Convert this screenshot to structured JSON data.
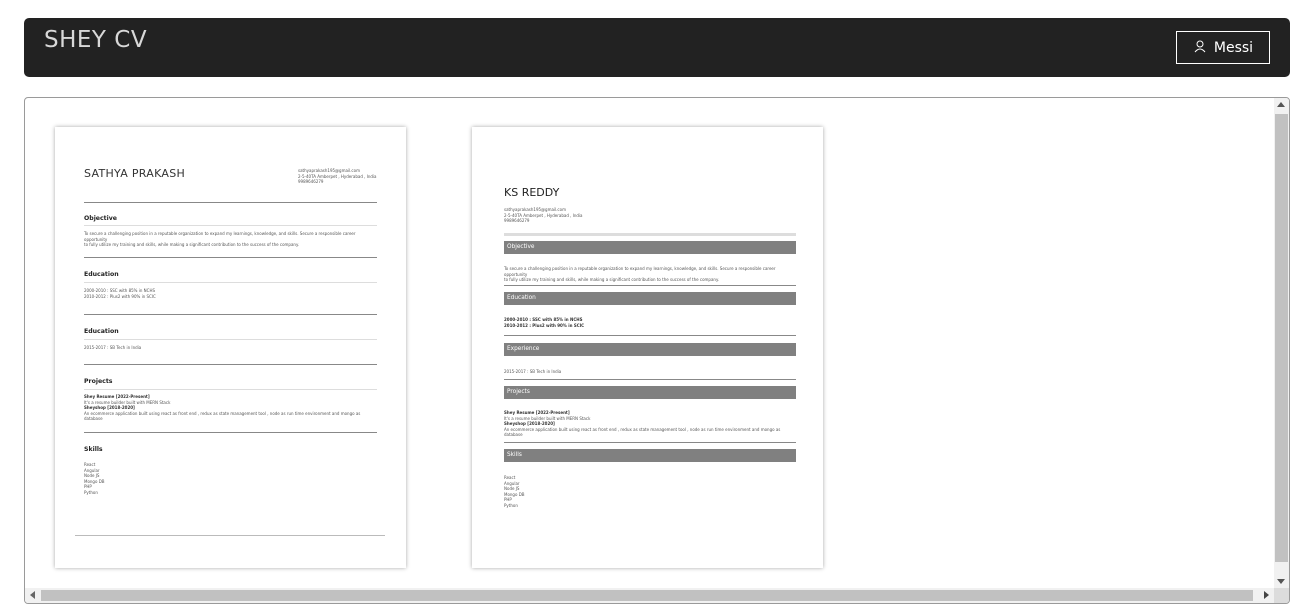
{
  "header": {
    "brand": "SHEY CV",
    "user_name": "Messi",
    "user_icon": "user-icon"
  },
  "templates": [
    {
      "name": "SATHYA PRAKASH",
      "contact": [
        "sathyaprakash195@gmail.com",
        "2-5-40TA Amberpet , Hyderabad , India",
        "9989646279"
      ],
      "sections": [
        {
          "title": "Objective",
          "lines": [
            "To secure a challenging position in a reputable organization to expand my learnings, knowledge, and skills. Secure a responsible career opportunity",
            "to fully utilize my training and skills, while making a significant contribution to the success of the company."
          ]
        },
        {
          "title": "Education",
          "lines": [
            "2000-2010 :  SSC with 85% in NCHS",
            "2010-2012 :  Plus2 with 90% in SCIC"
          ]
        },
        {
          "title": "Education",
          "lines": [
            "2015-2017 :  SB Tech in India"
          ]
        },
        {
          "title": "Projects",
          "lines": [
            "Shey Resume [2022-Present]",
            "It's a resume builder built with MERN Stack",
            "Sheyshop [2018-2020]",
            "An ecommerce application built using react as front end , redux as state management tool , node as run time environment and mongo as database"
          ]
        },
        {
          "title": "Skills",
          "lines": [
            "React",
            "Angular",
            "Node JS",
            "Mongo DB",
            "PHP",
            "Python"
          ]
        }
      ]
    },
    {
      "name": "KS REDDY",
      "contact": [
        "sathyaprakash195@gmail.com",
        "2-5-40TA Amberpet , Hyderabad , India",
        "9989646279"
      ],
      "sections": [
        {
          "title": "Objective",
          "lines": [
            "To secure a challenging position in a reputable organization to expand my learnings, knowledge, and skills. Secure a responsible career opportunity",
            "to fully utilize my training and skills, while making a significant contribution to the success of the company."
          ]
        },
        {
          "title": "Education",
          "lines": [
            "2000-2010 :  SSC with 85% in NCHS",
            "2010-2012 :  Plus2 with 90% in SCIC"
          ]
        },
        {
          "title": "Experience",
          "lines": [
            "2015-2017 :  SB Tech in India"
          ]
        },
        {
          "title": "Projects",
          "lines": [
            "Shey Resume [2022-Present]",
            "It's a resume builder built with MERN Stack",
            "Sheyshop [2018-2020]",
            "An ecommerce application built using react as front end , redux as state management tool , node as run time environment and mongo as database"
          ]
        },
        {
          "title": "Skills",
          "lines": [
            "React",
            "Angular",
            "Node JS",
            "Mongo DB",
            "PHP",
            "Python"
          ]
        }
      ]
    }
  ]
}
